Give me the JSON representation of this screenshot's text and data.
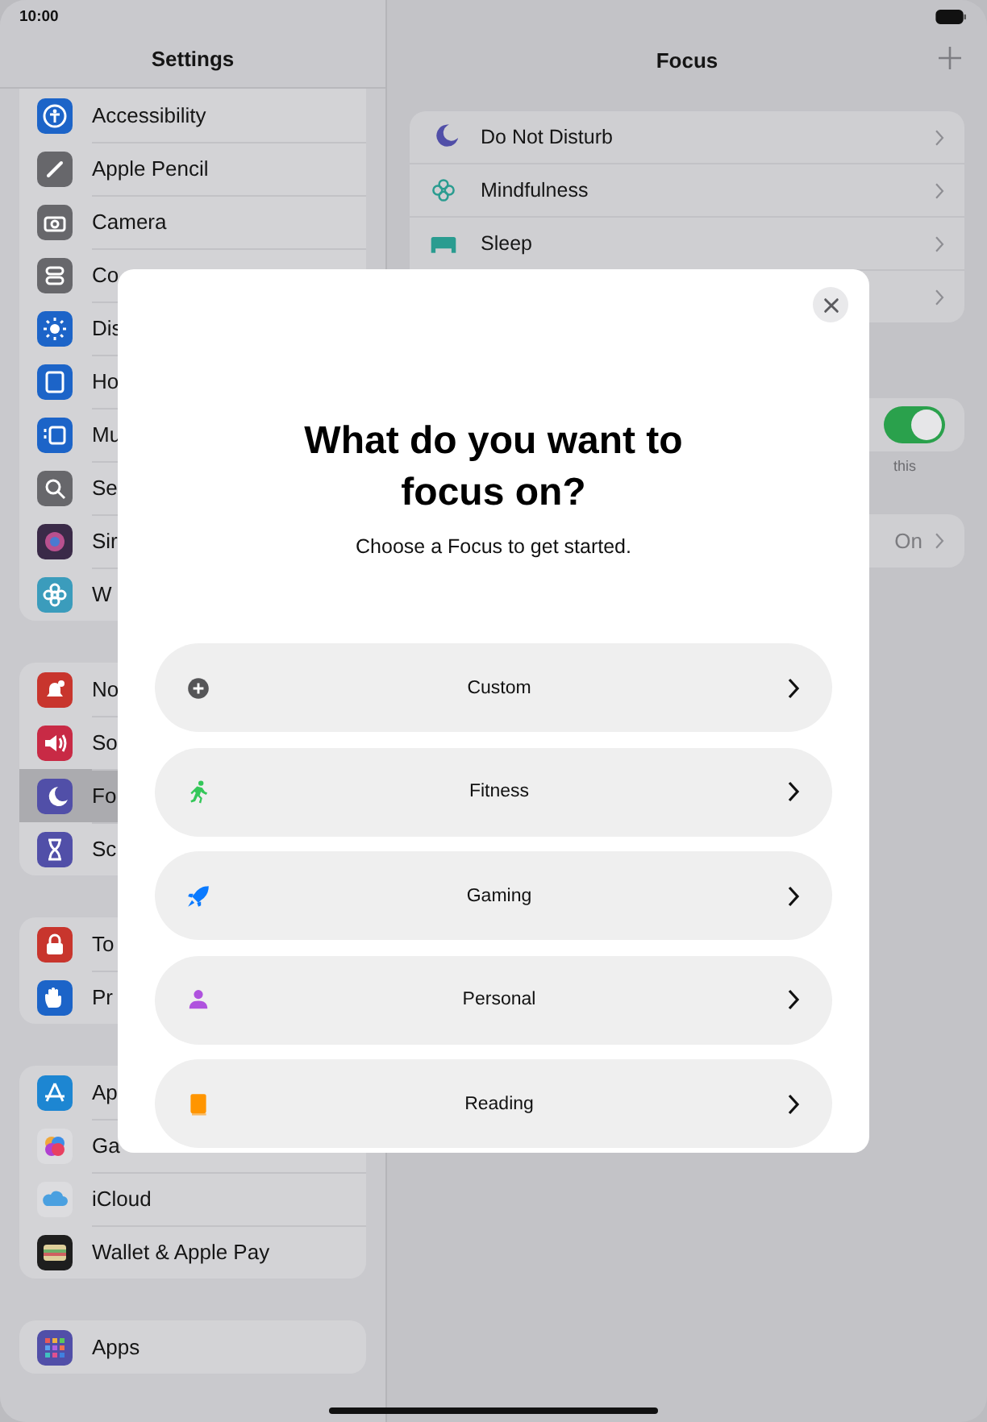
{
  "status_bar": {
    "time": "10:00"
  },
  "sidebar": {
    "title": "Settings",
    "groups": [
      {
        "items": [
          {
            "label": "Accessibility",
            "color": "#1c64c8",
            "selected": false
          },
          {
            "label": "Apple Pencil",
            "color": "#67676b",
            "selected": false
          },
          {
            "label": "Camera",
            "color": "#67676b",
            "selected": false
          },
          {
            "label": "Co",
            "color": "#67676b",
            "selected": false
          },
          {
            "label": "Dis",
            "color": "#1c64c8",
            "selected": false
          },
          {
            "label": "Ho",
            "color": "#1c64c8",
            "selected": false
          },
          {
            "label": "Mu",
            "color": "#1c64c8",
            "selected": false
          },
          {
            "label": "Se",
            "color": "#67676b",
            "selected": false
          },
          {
            "label": "Sir",
            "color": "#3a2a48",
            "selected": false
          },
          {
            "label": "W",
            "color": "#3b9cbc",
            "selected": false
          }
        ]
      },
      {
        "items": [
          {
            "label": "No",
            "color": "#c8352d",
            "selected": false
          },
          {
            "label": "So",
            "color": "#c82a45",
            "selected": false
          },
          {
            "label": "Fo",
            "color": "#514fa8",
            "selected": true
          },
          {
            "label": "Sc",
            "color": "#514fa8",
            "selected": false
          }
        ]
      },
      {
        "items": [
          {
            "label": "To",
            "color": "#c8352d",
            "selected": false
          },
          {
            "label": "Pr",
            "color": "#1c64c8",
            "selected": false
          }
        ]
      },
      {
        "items": [
          {
            "label": "Ap",
            "color": "#1d86d2",
            "selected": false
          },
          {
            "label": "Ga",
            "color": "#dcdcdf",
            "selected": false
          },
          {
            "label": "iCloud",
            "color": "#dcdcdf",
            "selected": false
          },
          {
            "label": "Wallet & Apple Pay",
            "color": "#1e1e1e",
            "selected": false
          }
        ]
      },
      {
        "items": [
          {
            "label": "Apps",
            "color": "#514fa8",
            "selected": false
          }
        ]
      }
    ]
  },
  "detail": {
    "title": "Focus",
    "focus_modes": [
      {
        "label": "Do Not Disturb",
        "color": "#514fa8"
      },
      {
        "label": "Mindfulness",
        "color": "#2a9c90"
      },
      {
        "label": "Sleep",
        "color": "#2a9c90"
      }
    ],
    "share_toggle": {
      "on": true
    },
    "footer_fragment": "this",
    "status_row": {
      "value": "On"
    }
  },
  "modal": {
    "title": "What do you want to focus on?",
    "subtitle": "Choose a Focus to get started.",
    "options": [
      {
        "label": "Custom",
        "color": "#555557"
      },
      {
        "label": "Fitness",
        "color": "#34c759"
      },
      {
        "label": "Gaming",
        "color": "#0a7aff"
      },
      {
        "label": "Personal",
        "color": "#af52de"
      },
      {
        "label": "Reading",
        "color": "#ff9500"
      }
    ]
  }
}
